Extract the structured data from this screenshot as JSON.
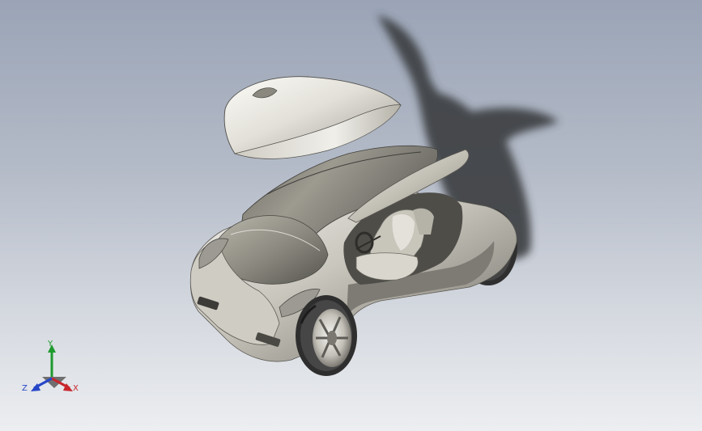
{
  "viewport": {
    "background_top": "#9aa4b6",
    "background_bottom": "#eceef1"
  },
  "model": {
    "icon": "concept-car-icon",
    "body_color": "#c9c6bd",
    "shadow_color": "#3b3d40",
    "tire_color": "#3a3a3a",
    "rim_color": "#d8d6cf"
  },
  "triad": {
    "icon": "coordinate-triad-icon",
    "x_label": "X",
    "y_label": "Y",
    "z_label": "Z",
    "x_color": "#c8262b",
    "y_color": "#1f9a2e",
    "z_color": "#2646c8"
  }
}
